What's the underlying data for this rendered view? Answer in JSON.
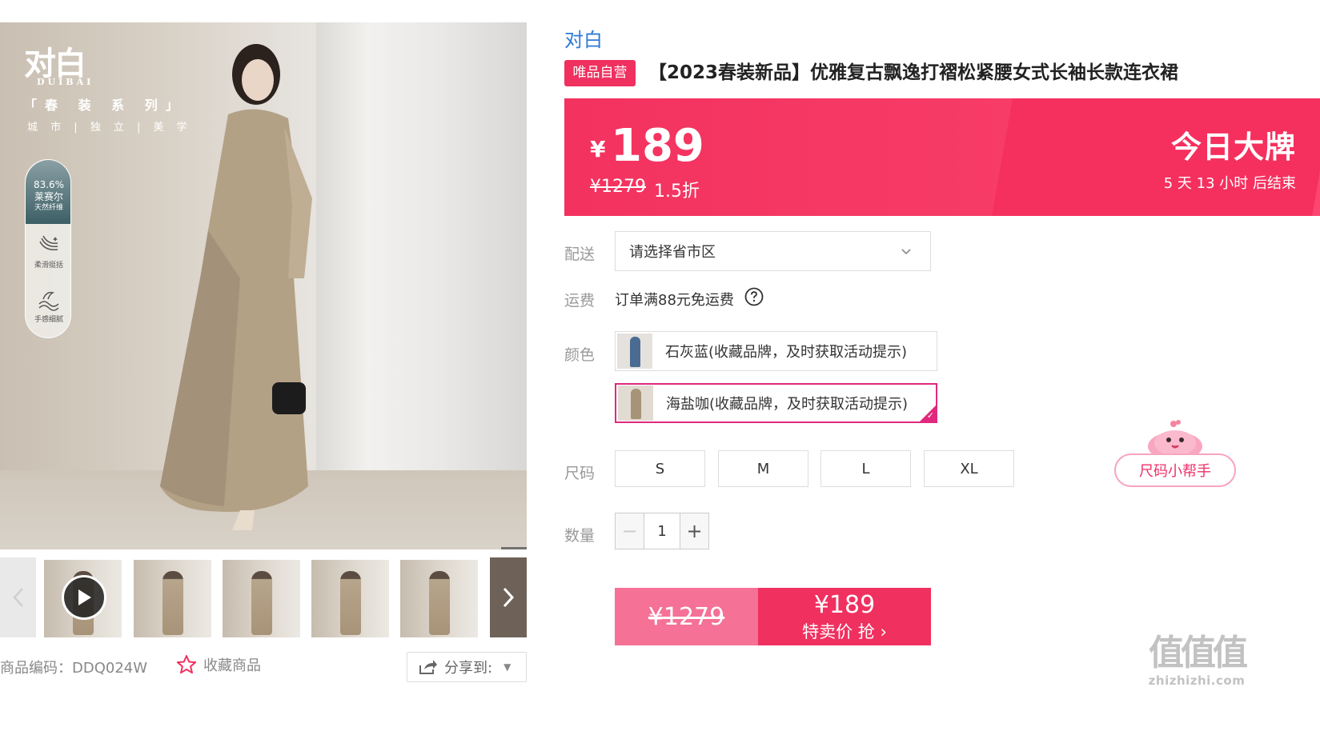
{
  "gallery": {
    "logo_text": "对白",
    "logo_sub": "DUIBAI",
    "series_title": "「春 装 系 列」",
    "series_sub": "城 市 | 独 立 | 美 学",
    "fiber_percent": "83.6%",
    "fiber_name": "莱赛尔",
    "fiber_desc": "天然纤维",
    "features": [
      {
        "label": "柔滑挺括",
        "icon": "drape-icon"
      },
      {
        "label": "手感细腻",
        "icon": "wave-icon"
      }
    ],
    "thumbnails_count": 6
  },
  "sku": {
    "code": "商品编码：DDQ024W",
    "favorite_label": "收藏商品",
    "share_label": "分享到:"
  },
  "product": {
    "brand": "对白",
    "badge": "唯品自营",
    "title": "【2023春装新品】优雅复古飘逸打褶松紧腰女式长袖长款连衣裙"
  },
  "price": {
    "currency": "¥",
    "current": "189",
    "original": "¥1279",
    "discount": "1.5折",
    "promo_title": "今日大牌",
    "countdown": "5 天 13 小时 后结束"
  },
  "options": {
    "delivery_label": "配送",
    "delivery_placeholder": "请选择省市区",
    "shipping_label": "运费",
    "shipping_text": "订单满88元免运费",
    "color_label": "颜色",
    "colors": [
      {
        "name": "石灰蓝(收藏品牌，及时获取活动提示)",
        "selected": false,
        "swatch": "#4a6c93"
      },
      {
        "name": "海盐咖(收藏品牌，及时获取活动提示)",
        "selected": true,
        "swatch": "#a79378"
      }
    ],
    "size_label": "尺码",
    "sizes": [
      "S",
      "M",
      "L",
      "XL"
    ],
    "size_helper": "尺码小帮手",
    "quantity_label": "数量",
    "quantity": "1"
  },
  "buy": {
    "original_price": "¥1279",
    "price": "¥189",
    "action": "特卖价 抢 ›"
  },
  "watermark": {
    "big": "值值值",
    "small": "zhizhizhi.com"
  },
  "colors": {
    "accent": "#f0305f",
    "brand_link": "#2e7ad6",
    "selected_border": "#e0297d"
  }
}
